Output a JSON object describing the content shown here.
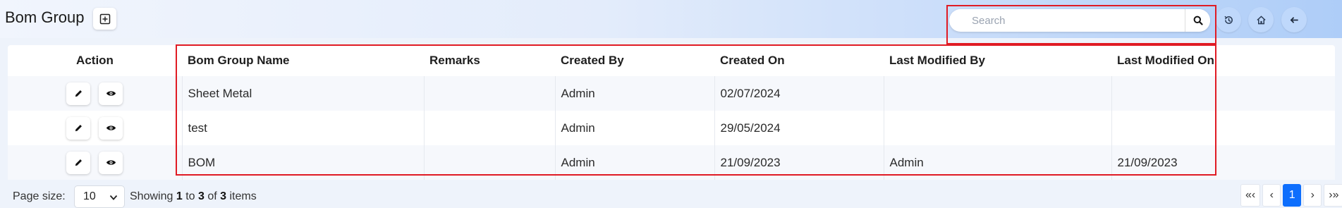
{
  "header": {
    "title": "Bom Group",
    "search_placeholder": "Search",
    "search_value": ""
  },
  "icons": {
    "add": "plus-square-icon",
    "search": "search-icon",
    "reset": "history-icon",
    "home": "home-icon",
    "back": "arrow-left-icon",
    "edit": "pencil-icon",
    "view": "eye-icon"
  },
  "table": {
    "columns": [
      "Action",
      "Bom Group Name",
      "Remarks",
      "Created By",
      "Created On",
      "Last Modified By",
      "Last Modified On"
    ],
    "rows": [
      {
        "name": "Sheet Metal",
        "remarks": "",
        "created_by": "Admin",
        "created_on": "02/07/2024",
        "modified_by": "",
        "modified_on": ""
      },
      {
        "name": "test",
        "remarks": "",
        "created_by": "Admin",
        "created_on": "29/05/2024",
        "modified_by": "",
        "modified_on": ""
      },
      {
        "name": "BOM",
        "remarks": "",
        "created_by": "Admin",
        "created_on": "21/09/2023",
        "modified_by": "Admin",
        "modified_on": "21/09/2023"
      }
    ]
  },
  "footer": {
    "page_size_label": "Page size:",
    "page_size_value": "10",
    "showing_prefix": "Showing",
    "showing_from": "1",
    "showing_to_word": "to",
    "showing_to": "3",
    "showing_of_word": "of",
    "showing_total": "3",
    "showing_suffix": "items",
    "pager": {
      "first": "«‹",
      "prev": "‹",
      "current": "1",
      "next": "›",
      "last": "›»"
    }
  },
  "colors": {
    "highlight": "#e01b24",
    "active_page": "#0d6efd"
  }
}
